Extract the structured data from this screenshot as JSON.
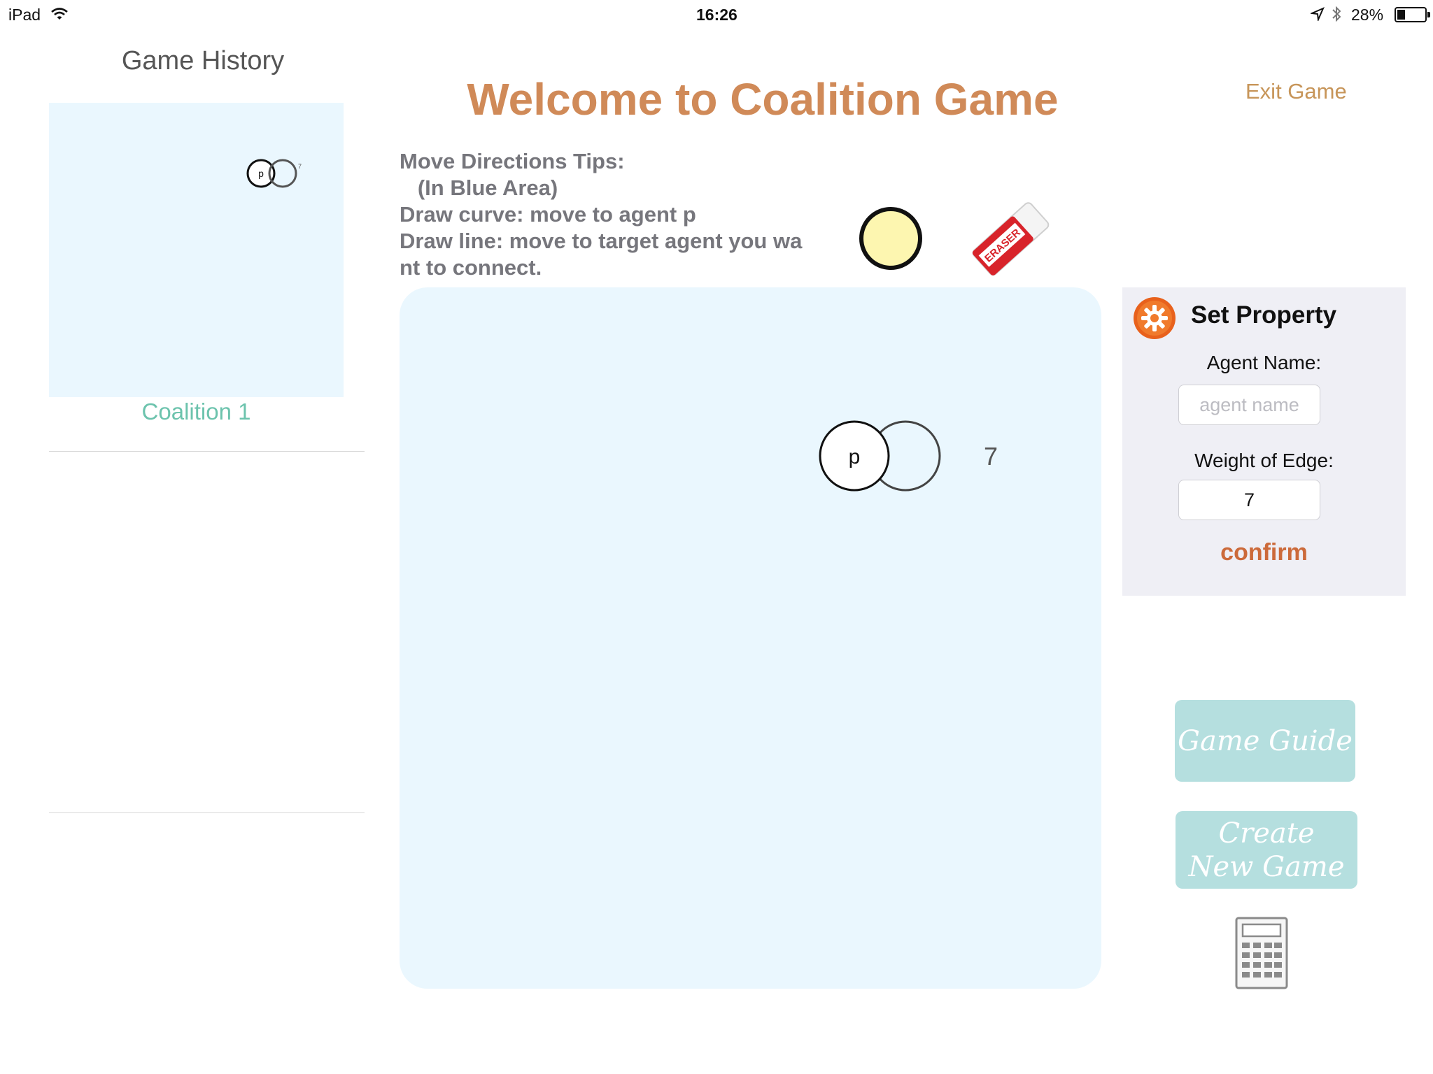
{
  "status_bar": {
    "device": "iPad",
    "time": "16:26",
    "battery": "28%"
  },
  "sidebar": {
    "title": "Game History",
    "items": [
      {
        "label": "Coalition 1",
        "agent": "p",
        "weight": "7"
      }
    ]
  },
  "main": {
    "title": "Welcome to Coalition Game",
    "exit_label": "Exit Game",
    "tips": [
      "Move Directions Tips:",
      "   (In Blue Area)",
      "Draw curve: move to agent p",
      "Draw line: move to target agent you wa",
      "nt to connect."
    ],
    "tools": {
      "node_tool": "yellow-circle",
      "eraser_label": "ERASER"
    },
    "canvas": {
      "agent": "p",
      "edge_weight": "7"
    }
  },
  "property_panel": {
    "title": "Set Property",
    "agent_name_label": "Agent Name:",
    "agent_name_placeholder": "agent name",
    "agent_name_value": "",
    "weight_label": "Weight of Edge:",
    "weight_value": "7",
    "confirm_label": "confirm"
  },
  "actions": {
    "game_guide_label": "Game Guide",
    "create_game_label_line1": "Create",
    "create_game_label_line2": "New Game"
  },
  "colors": {
    "title": "#d08a58",
    "canvas_bg": "#eaf7fe",
    "teal_button": "#b5dfdf",
    "confirm": "#cc6a3a",
    "node_fill": "#fdf6b0"
  }
}
